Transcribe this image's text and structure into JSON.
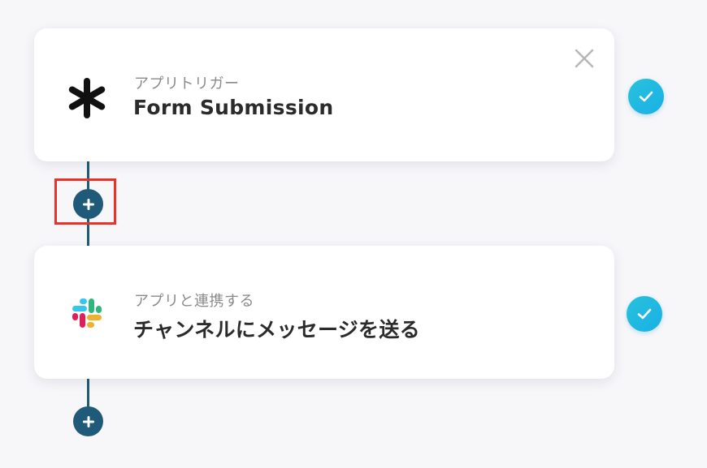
{
  "steps": [
    {
      "subtitle": "アプリトリガー",
      "title": "Form Submission",
      "icon": "asterisk-icon",
      "status": "completed"
    },
    {
      "subtitle": "アプリと連携する",
      "title": "チャンネルにメッセージを送る",
      "icon": "slack-logo-icon",
      "status": "completed"
    }
  ],
  "colors": {
    "accent": "#1f5a78",
    "check": "#1ab0e6",
    "highlight": "#e8332a",
    "background": "#f7f7fa"
  }
}
